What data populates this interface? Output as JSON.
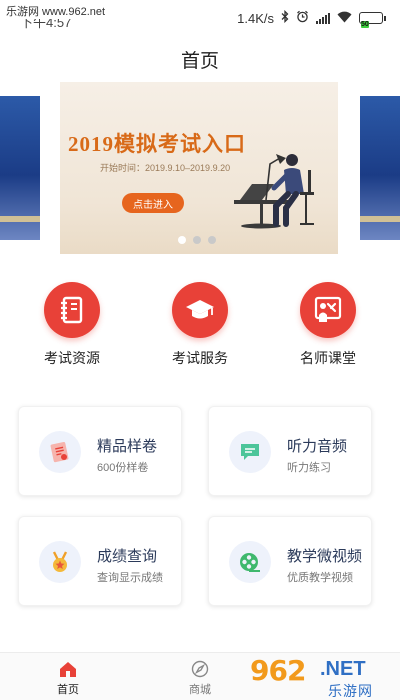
{
  "watermark": {
    "top": "乐游网 www.962.net",
    "bottom_number": "962",
    "bottom_net": ".NET",
    "bottom_cn": "乐游网"
  },
  "status_bar": {
    "time": "下午4:57",
    "speed": "1.4K/s",
    "battery": "50"
  },
  "header": {
    "title": "首页"
  },
  "banner": {
    "title": "2019模拟考试入口",
    "date_text": "开始时间：2019.9.10–2019.9.20",
    "button_label": "点击进入",
    "dots": 3,
    "active_dot": 0
  },
  "quick_actions": [
    {
      "label": "考试资源",
      "icon": "notebook-icon"
    },
    {
      "label": "考试服务",
      "icon": "graduation-cap-icon"
    },
    {
      "label": "名师课堂",
      "icon": "teacher-icon"
    }
  ],
  "cards": [
    {
      "title": "精品样卷",
      "subtitle": "600份样卷",
      "icon": "exam-paper-icon"
    },
    {
      "title": "听力音频",
      "subtitle": "听力练习",
      "icon": "chat-bubble-icon"
    },
    {
      "title": "成绩查询",
      "subtitle": "查询显示成绩",
      "icon": "medal-icon"
    },
    {
      "title": "教学微视频",
      "subtitle": "优质教学视频",
      "icon": "film-reel-icon"
    }
  ],
  "tabs": [
    {
      "label": "首页",
      "icon": "home-icon",
      "active": true
    },
    {
      "label": "商城",
      "icon": "compass-icon",
      "active": false
    }
  ],
  "colors": {
    "accent": "#e84138",
    "banner_title": "#d86a18",
    "button": "#e6651e"
  }
}
